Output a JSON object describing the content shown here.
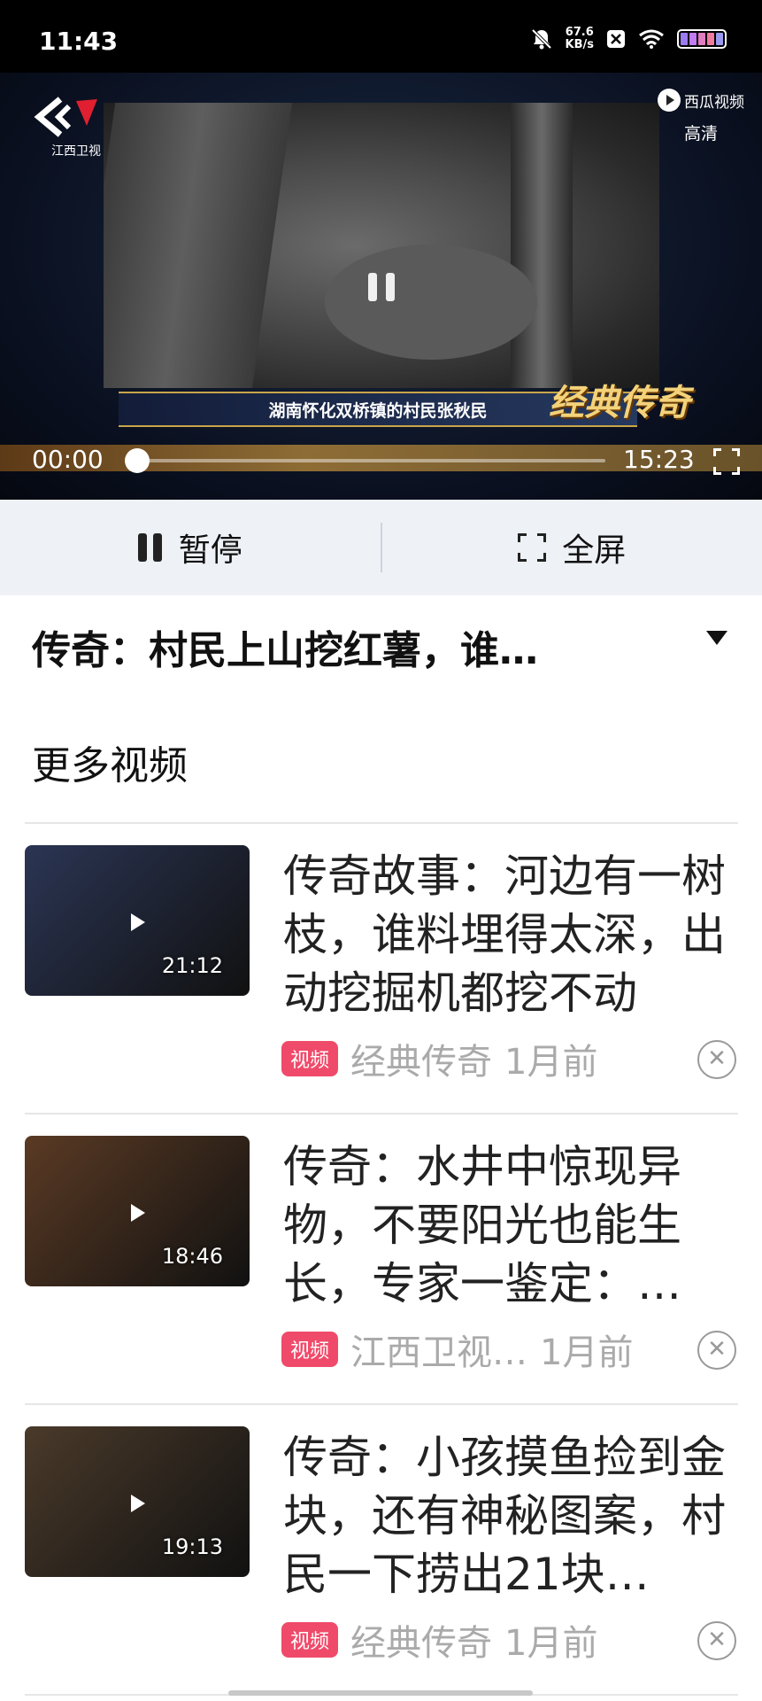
{
  "status_bar": {
    "time": "11:43",
    "net_speed_value": "67.6",
    "net_speed_unit": "KB/s",
    "battery_colors": [
      "#9a7cf0",
      "#c07cf0",
      "#e07cc0",
      "#f07ca0",
      "#9a9af0"
    ]
  },
  "player": {
    "channel_name": "江西卫视",
    "brand": "西瓜视频",
    "quality": "高清",
    "caption": "湖南怀化双桥镇的村民张秋民",
    "show_logo": "经典传奇",
    "current_time": "00:00",
    "total_time": "15:23",
    "progress": 0
  },
  "controls": {
    "pause_label": "暂停",
    "fullscreen_label": "全屏"
  },
  "video_title": "传奇：村民上山挖红薯，谁…",
  "more_videos": {
    "heading": "更多视频",
    "items": [
      {
        "title": "传奇故事：河边有一树枝，谁料埋得太深，出动挖掘机都挖不动",
        "duration": "21:12",
        "badge": "视频",
        "source": "经典传奇",
        "time_ago": "1月前",
        "thumb_color": "#2b3554"
      },
      {
        "title": "传奇：水井中惊现异物，不要阳光也能生长，专家一鉴定：…",
        "duration": "18:46",
        "badge": "视频",
        "source": "江西卫视…",
        "time_ago": "1月前",
        "thumb_color": "#5a3a24"
      },
      {
        "title": "传奇：小孩摸鱼捡到金块，还有神秘图案，村民一下捞出21块…",
        "duration": "19:13",
        "badge": "视频",
        "source": "经典传奇",
        "time_ago": "1月前",
        "thumb_color": "#4a3a2a"
      }
    ]
  }
}
